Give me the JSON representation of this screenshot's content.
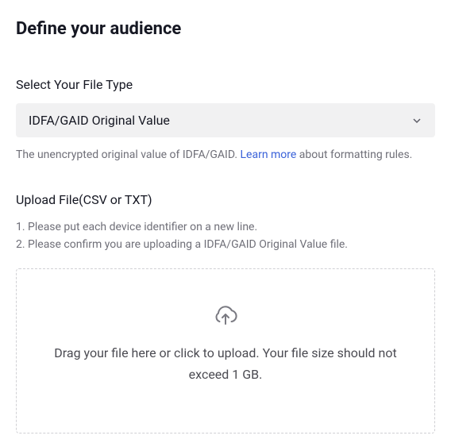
{
  "page": {
    "title": "Define your audience"
  },
  "fileType": {
    "label": "Select Your File Type",
    "selected": "IDFA/GAID Original Value",
    "helper_pre": "The unencrypted original value of IDFA/GAID. ",
    "helper_link": "Learn more",
    "helper_post": " about formatting rules."
  },
  "upload": {
    "label": "Upload File(CSV or TXT)",
    "instruction1": "1. Please put each device identifier on a new line.",
    "instruction2": "2. Please confirm you are uploading a IDFA/GAID Original Value file.",
    "dropzone_text": "Drag your file here or click to upload. Your file size should not exceed 1 GB."
  }
}
